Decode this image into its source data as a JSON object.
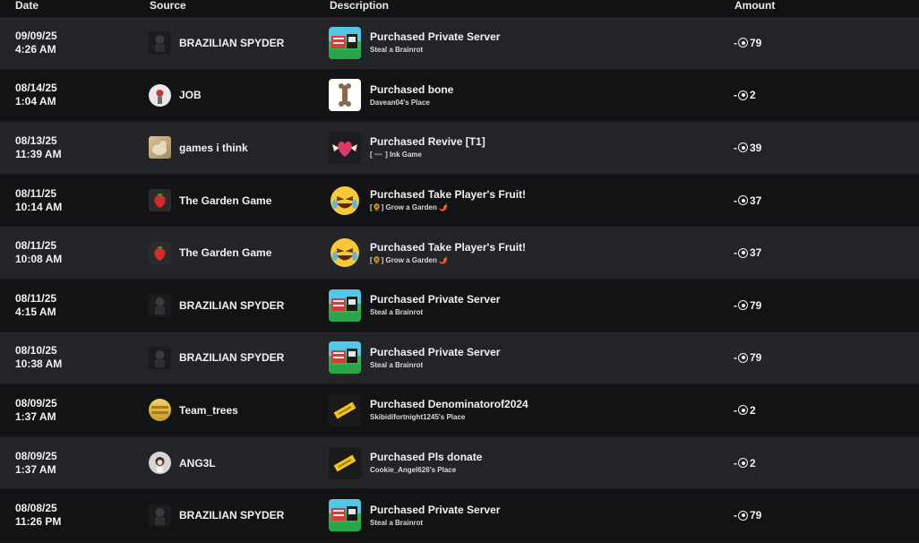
{
  "headers": {
    "date": "Date",
    "source": "Source",
    "description": "Description",
    "amount": "Amount"
  },
  "rows": [
    {
      "date": "09/09/25",
      "time": "4:26 AM",
      "source": "BRAZILIAN SPYDER",
      "title": "Purchased Private Server",
      "subtitle": "Steal a Brainrot",
      "amount": "-79",
      "src_icon": "spyder-avatar-icon",
      "desc_icon": "brainrot-game-icon"
    },
    {
      "date": "08/14/25",
      "time": "1:04 AM",
      "source": "JOB",
      "title": "Purchased bone",
      "subtitle": "Davean04's Place",
      "amount": "-2",
      "src_icon": "job-avatar-icon",
      "desc_icon": "bone-icon"
    },
    {
      "date": "08/13/25",
      "time": "11:39 AM",
      "source": "games i think",
      "title": "Purchased Revive [T1]",
      "subtitle": "[ ➖ ] Ink Game",
      "amount": "-39",
      "src_icon": "games-avatar-icon",
      "desc_icon": "winged-heart-icon"
    },
    {
      "date": "08/11/25",
      "time": "10:14 AM",
      "source": "The Garden Game",
      "title": "Purchased Take Player's Fruit!",
      "subtitle": "[🌻] Grow a Garden 🌶️",
      "amount": "-37",
      "src_icon": "strawberry-icon",
      "desc_icon": "laughing-emoji-icon"
    },
    {
      "date": "08/11/25",
      "time": "10:08 AM",
      "source": "The Garden Game",
      "title": "Purchased Take Player's Fruit!",
      "subtitle": "[🌻] Grow a Garden 🌶️",
      "amount": "-37",
      "src_icon": "strawberry-icon",
      "desc_icon": "laughing-emoji-icon"
    },
    {
      "date": "08/11/25",
      "time": "4:15 AM",
      "source": "BRAZILIAN SPYDER",
      "title": "Purchased Private Server",
      "subtitle": "Steal a Brainrot",
      "amount": "-79",
      "src_icon": "spyder-avatar-icon",
      "desc_icon": "brainrot-game-icon"
    },
    {
      "date": "08/10/25",
      "time": "10:38 AM",
      "source": "BRAZILIAN SPYDER",
      "title": "Purchased Private Server",
      "subtitle": "Steal a Brainrot",
      "amount": "-79",
      "src_icon": "spyder-avatar-icon",
      "desc_icon": "brainrot-game-icon"
    },
    {
      "date": "08/09/25",
      "time": "1:37 AM",
      "source": "Team_trees",
      "title": "Purchased Denominatorof2024",
      "subtitle": "Skibidifortnight1245's Place",
      "amount": "-2",
      "src_icon": "trees-avatar-icon",
      "desc_icon": "gold-bar-icon"
    },
    {
      "date": "08/09/25",
      "time": "1:37 AM",
      "source": "ANG3L",
      "title": "Purchased Pls donate",
      "subtitle": "Cookie_Angel626's Place",
      "amount": "-2",
      "src_icon": "angel-avatar-icon",
      "desc_icon": "gold-bar-icon"
    },
    {
      "date": "08/08/25",
      "time": "11:26 PM",
      "source": "BRAZILIAN SPYDER",
      "title": "Purchased Private Server",
      "subtitle": "Steal a Brainrot",
      "amount": "-79",
      "src_icon": "spyder-avatar-icon",
      "desc_icon": "brainrot-game-icon"
    }
  ],
  "colors": {
    "row_alt": "#232428",
    "row_plain": "#121315",
    "text": "#f0f1f2"
  }
}
